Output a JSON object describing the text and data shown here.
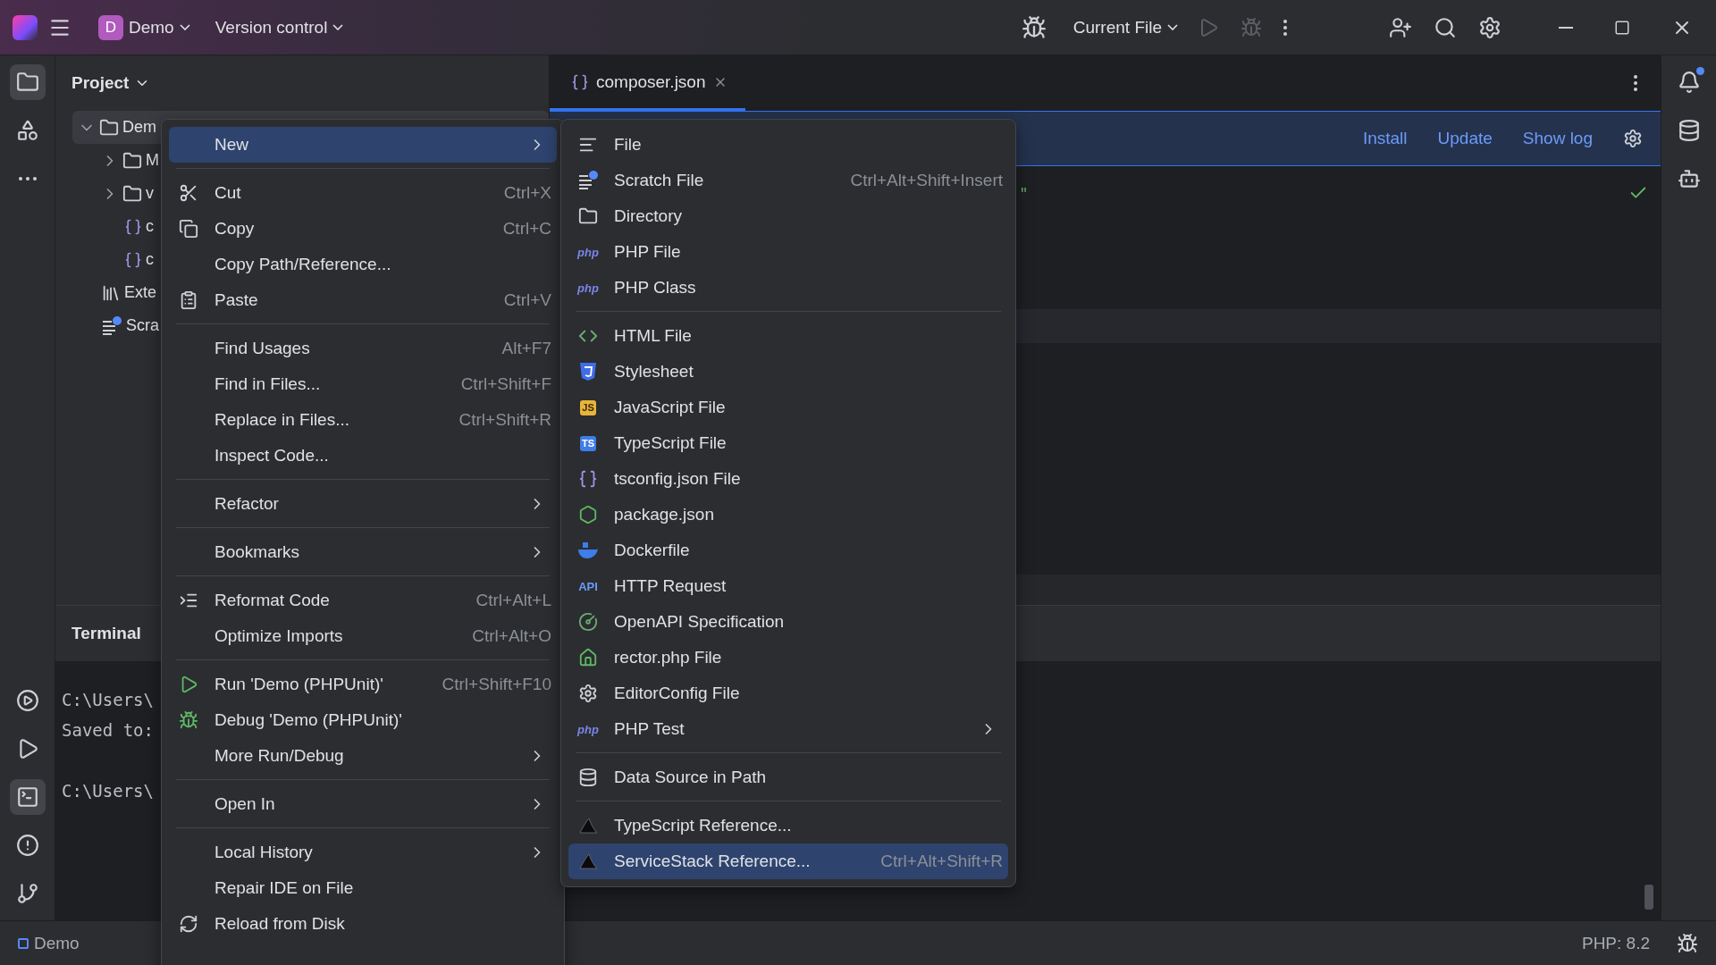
{
  "title_bar": {
    "project_initial": "D",
    "project_name": "Demo",
    "vcs": "Version control",
    "run_config": "Current File",
    "run_disabled": true,
    "debug_disabled": true
  },
  "left_tools": [
    {
      "kind": "project",
      "selected": true
    },
    {
      "kind": "structure",
      "selected": false
    },
    {
      "kind": "more",
      "selected": false
    }
  ],
  "left_tools_bottom": [
    {
      "kind": "services",
      "selected": false
    },
    {
      "kind": "run",
      "selected": false
    },
    {
      "kind": "terminal",
      "selected": true
    },
    {
      "kind": "problems",
      "selected": false
    },
    {
      "kind": "git",
      "selected": false
    }
  ],
  "project_panel": {
    "title": "Project",
    "tree": [
      {
        "label": "Dem",
        "kind": "folder",
        "expanded": true,
        "selected": true,
        "children": [
          {
            "label": "M",
            "kind": "folder",
            "expanded": false,
            "selected": false
          },
          {
            "label": "v",
            "kind": "folder",
            "expanded": false,
            "selected": false
          },
          {
            "label": "c",
            "kind": "json",
            "selected": false
          },
          {
            "label": "c",
            "kind": "json",
            "selected": false
          }
        ]
      },
      {
        "label": "Exte",
        "kind": "library",
        "selected": false
      },
      {
        "label": "Scra",
        "kind": "scratch",
        "selected": false
      }
    ]
  },
  "editor": {
    "tabs": [
      {
        "label": "composer.json",
        "selected": true
      }
    ],
    "banner": {
      "actions": [
        "Install",
        "Update",
        "Show log"
      ]
    },
    "code_fragment": "\""
  },
  "terminal": {
    "title": "Terminal",
    "blocks": [
      {
        "lines": [
          "C:\\Users\\",
          "Saved to:"
        ]
      },
      {
        "lines": [
          "C:\\Users\\"
        ]
      }
    ]
  },
  "right_tools": [
    {
      "kind": "notifications",
      "unread": true
    },
    {
      "kind": "database",
      "unread": false
    },
    {
      "kind": "assistant",
      "unread": false
    }
  ],
  "status_bar": {
    "project": "Demo",
    "php": "PHP: 8.2"
  },
  "context_menu": {
    "groups": [
      {
        "items": [
          {
            "kind": "plain",
            "label": "New",
            "submenu": true,
            "selected": true
          }
        ]
      },
      {
        "items": [
          {
            "kind": "cut",
            "label": "Cut",
            "shortcut": "Ctrl+X",
            "selected": false
          },
          {
            "kind": "copy",
            "label": "Copy",
            "shortcut": "Ctrl+C",
            "selected": false
          },
          {
            "kind": "plain",
            "label": "Copy Path/Reference...",
            "selected": false
          },
          {
            "kind": "paste",
            "label": "Paste",
            "shortcut": "Ctrl+V",
            "selected": false
          }
        ]
      },
      {
        "items": [
          {
            "kind": "plain",
            "label": "Find Usages",
            "shortcut": "Alt+F7",
            "selected": false
          },
          {
            "kind": "plain",
            "label": "Find in Files...",
            "shortcut": "Ctrl+Shift+F",
            "selected": false
          },
          {
            "kind": "plain",
            "label": "Replace in Files...",
            "shortcut": "Ctrl+Shift+R",
            "selected": false
          },
          {
            "kind": "plain",
            "label": "Inspect Code...",
            "selected": false
          }
        ]
      },
      {
        "items": [
          {
            "kind": "plain",
            "label": "Refactor",
            "submenu": true,
            "selected": false
          }
        ]
      },
      {
        "items": [
          {
            "kind": "plain",
            "label": "Bookmarks",
            "submenu": true,
            "selected": false
          }
        ]
      },
      {
        "items": [
          {
            "kind": "reformat",
            "label": "Reformat Code",
            "shortcut": "Ctrl+Alt+L",
            "selected": false
          },
          {
            "kind": "plain",
            "label": "Optimize Imports",
            "shortcut": "Ctrl+Alt+O",
            "selected": false
          }
        ]
      },
      {
        "items": [
          {
            "kind": "run",
            "label": "Run 'Demo (PHPUnit)'",
            "shortcut": "Ctrl+Shift+F10",
            "selected": false
          },
          {
            "kind": "debug",
            "label": "Debug 'Demo (PHPUnit)'",
            "selected": false
          },
          {
            "kind": "plain",
            "label": "More Run/Debug",
            "submenu": true,
            "selected": false
          }
        ]
      },
      {
        "items": [
          {
            "kind": "plain",
            "label": "Open In",
            "submenu": true,
            "selected": false
          }
        ]
      },
      {
        "items": [
          {
            "kind": "plain",
            "label": "Local History",
            "submenu": true,
            "selected": false
          },
          {
            "kind": "plain",
            "label": "Repair IDE on File",
            "selected": false
          },
          {
            "kind": "reload",
            "label": "Reload from Disk",
            "selected": false
          }
        ]
      }
    ]
  },
  "new_submenu": {
    "groups": [
      {
        "items": [
          {
            "kind": "file",
            "label": "File",
            "selected": false
          },
          {
            "kind": "scratch",
            "label": "Scratch File",
            "shortcut": "Ctrl+Alt+Shift+Insert",
            "selected": false
          },
          {
            "kind": "directory",
            "label": "Directory",
            "selected": false
          },
          {
            "kind": "php",
            "badge": "php",
            "label": "PHP File",
            "selected": false
          },
          {
            "kind": "php",
            "badge": "php",
            "label": "PHP Class",
            "selected": false
          }
        ]
      },
      {
        "items": [
          {
            "kind": "html",
            "label": "HTML File",
            "selected": false
          },
          {
            "kind": "css",
            "label": "Stylesheet",
            "selected": false
          },
          {
            "kind": "js",
            "badge": "JS",
            "label": "JavaScript File",
            "selected": false
          },
          {
            "kind": "ts",
            "badge": "TS",
            "label": "TypeScript File",
            "selected": false
          },
          {
            "kind": "tsconfig",
            "label": "tsconfig.json File",
            "selected": false
          },
          {
            "kind": "package",
            "label": "package.json",
            "selected": false
          },
          {
            "kind": "docker",
            "label": "Dockerfile",
            "selected": false
          },
          {
            "kind": "api",
            "badge": "API",
            "label": "HTTP Request",
            "selected": false
          },
          {
            "kind": "openapi",
            "label": "OpenAPI Specification",
            "selected": false
          },
          {
            "kind": "rector",
            "label": "rector.php File",
            "selected": false
          },
          {
            "kind": "editorconfig",
            "label": "EditorConfig File",
            "selected": false
          },
          {
            "kind": "php",
            "badge": "php",
            "label": "PHP Test",
            "submenu": true,
            "selected": false
          }
        ]
      },
      {
        "items": [
          {
            "kind": "datasource",
            "label": "Data Source in Path",
            "selected": false
          }
        ]
      },
      {
        "items": [
          {
            "kind": "servicestack",
            "label": "TypeScript Reference...",
            "selected": false
          },
          {
            "kind": "servicestack",
            "label": "ServiceStack Reference...",
            "shortcut": "Ctrl+Alt+Shift+R",
            "selected": true
          }
        ]
      }
    ]
  }
}
